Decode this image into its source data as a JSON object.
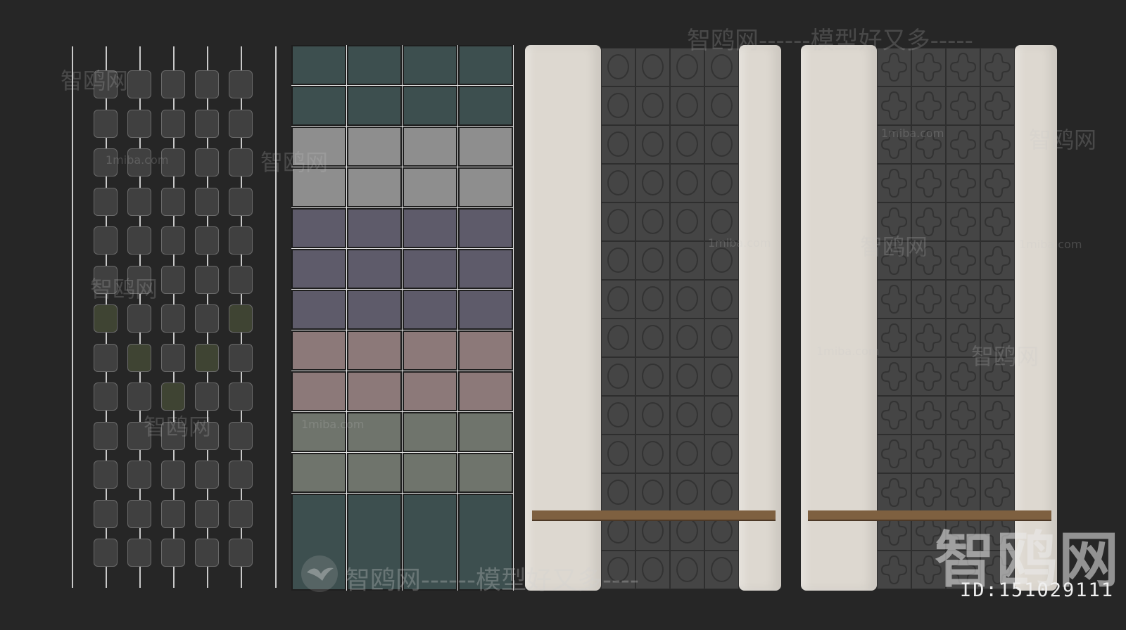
{
  "watermark": {
    "brand": "智鸥网",
    "tagline": "智鸥网------模型好又多-----",
    "tagline_bottom": "智鸥网------模型好又多----",
    "site": "1miba.com",
    "id_label": "ID:151029111"
  },
  "icons": [
    "seagull-logo-icon"
  ],
  "colors": {
    "background": "#262626",
    "tile_teal": "#3d4f4f",
    "tile_gray": "#8e8e8e",
    "tile_purple": "#5e5b6a",
    "tile_rose": "#8c7979",
    "tile_sage": "#6f746c",
    "panel_beige": "#ddd8d0",
    "shelf_wood": "#7e6040"
  }
}
